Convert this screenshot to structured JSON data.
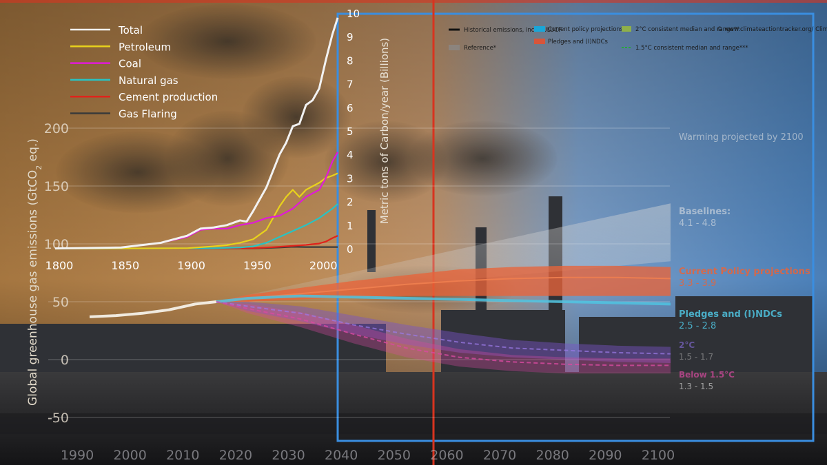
{
  "colors": {
    "sky_warm": "#b98a55",
    "sky_cool": "#5b8bbd",
    "frame_blue": "#3a8ee0",
    "divider_red": "#d8341f",
    "total": "#f2f2f2",
    "petroleum": "#e8d21c",
    "coal": "#e01ad8",
    "natural_gas": "#27c4c4",
    "cement": "#e0231b",
    "gas_flaring": "#3a3a3a",
    "current_policy": "#e8643a",
    "pledges": "#4fc3e0",
    "two_degree": "#7a55c8",
    "one_five_degree": "#d84aa0"
  },
  "chart_data": [
    {
      "type": "line",
      "xlabel": "",
      "ylabel": "Metric tons of Carbon/year (Billions)",
      "xlim": [
        1800,
        2014
      ],
      "ylim": [
        0,
        10
      ],
      "x_ticks": [
        "1800",
        "1850",
        "1900",
        "1950",
        "2000"
      ],
      "y_ticks": [
        "0",
        "1",
        "2",
        "3",
        "4",
        "5",
        "6",
        "7",
        "8",
        "9",
        "10"
      ],
      "legend_position": "top-left",
      "series": [
        {
          "name": "Total",
          "x": [
            1800,
            1850,
            1880,
            1900,
            1910,
            1920,
            1930,
            1940,
            1945,
            1950,
            1960,
            1970,
            1975,
            1980,
            1985,
            1990,
            1995,
            2000,
            2005,
            2010,
            2014
          ],
          "y": [
            0.01,
            0.05,
            0.25,
            0.55,
            0.85,
            0.9,
            1.0,
            1.2,
            1.15,
            1.6,
            2.6,
            4.0,
            4.5,
            5.2,
            5.3,
            6.1,
            6.3,
            6.8,
            8.0,
            9.1,
            9.8
          ]
        },
        {
          "name": "Petroleum",
          "x": [
            1800,
            1900,
            1920,
            1930,
            1940,
            1950,
            1960,
            1970,
            1975,
            1980,
            1985,
            1990,
            2000,
            2005,
            2010,
            2014
          ],
          "y": [
            0,
            0.02,
            0.1,
            0.15,
            0.25,
            0.4,
            0.8,
            1.8,
            2.2,
            2.5,
            2.2,
            2.5,
            2.8,
            3.0,
            3.1,
            3.2
          ]
        },
        {
          "name": "Coal",
          "x": [
            1800,
            1850,
            1880,
            1900,
            1910,
            1920,
            1930,
            1940,
            1950,
            1960,
            1970,
            1980,
            1990,
            2000,
            2005,
            2010,
            2014
          ],
          "y": [
            0.01,
            0.05,
            0.25,
            0.5,
            0.8,
            0.85,
            0.85,
            1.0,
            1.1,
            1.3,
            1.4,
            1.7,
            2.2,
            2.5,
            3.0,
            3.7,
            4.1
          ]
        },
        {
          "name": "Natural gas",
          "x": [
            1800,
            1920,
            1940,
            1950,
            1960,
            1970,
            1980,
            1990,
            2000,
            2005,
            2010,
            2014
          ],
          "y": [
            0,
            0.02,
            0.05,
            0.1,
            0.25,
            0.5,
            0.75,
            1.0,
            1.3,
            1.5,
            1.7,
            1.9
          ]
        },
        {
          "name": "Cement production",
          "x": [
            1800,
            1920,
            1950,
            1960,
            1970,
            1980,
            1990,
            2000,
            2005,
            2010,
            2014
          ],
          "y": [
            0,
            0.01,
            0.02,
            0.05,
            0.08,
            0.12,
            0.16,
            0.22,
            0.3,
            0.45,
            0.55
          ]
        },
        {
          "name": "Gas Flaring",
          "x": [
            1800,
            1950,
            1970,
            1980,
            1990,
            2000,
            2014
          ],
          "y": [
            0,
            0.01,
            0.05,
            0.08,
            0.07,
            0.07,
            0.07
          ]
        }
      ]
    },
    {
      "type": "line",
      "xlabel": "",
      "ylabel": "Global greenhouse gas emissions (GtCO₂eq.)",
      "ylabel_prefix": "Global greenhouse gas emissions (GtCO",
      "ylabel_sub": "2",
      "ylabel_suffix": " eq.)",
      "xlim": [
        1990,
        2100
      ],
      "ylim": [
        -50,
        200
      ],
      "x_ticks": [
        "1990",
        "2000",
        "2010",
        "2020",
        "2030",
        "2040",
        "2050",
        "2060",
        "2070",
        "2080",
        "2090",
        "2100"
      ],
      "y_ticks": [
        "-50",
        "0",
        "50",
        "100",
        "150",
        "200"
      ],
      "legend": [
        "Historical emissions, incl. LULUCF",
        "Reference*",
        "Current policy projections",
        "Pledges and (I)NDCs",
        "2°C consistent median and range**",
        "1.5°C consistent median and range***"
      ],
      "credit": "© www.climateactiontracker.org/ Climate Analytics/Ecofys/ NewClimate",
      "annotations": [
        {
          "title": "Warming projected by 2100",
          "value": ""
        },
        {
          "title": "Baselines:",
          "value": "4.1 - 4.8"
        },
        {
          "title": "Current Policy projections",
          "value": "3.3 - 3.9"
        },
        {
          "title": "Pledges and (I)NDCs",
          "value": "2.5 - 2.8"
        },
        {
          "title": "2°C",
          "value": "1.5 - 1.7"
        },
        {
          "title": "Below 1.5°C",
          "value": "1.3 - 1.5"
        }
      ],
      "series": [
        {
          "name": "Historical emissions, incl. LULUCF",
          "x": [
            1990,
            1995,
            2000,
            2005,
            2010,
            2014
          ],
          "y": [
            37,
            38,
            40,
            43,
            48,
            50
          ]
        },
        {
          "name": "Current policy projections",
          "x": [
            2014,
            2020,
            2030,
            2040,
            2050,
            2060,
            2070,
            2080,
            2090,
            2100
          ],
          "y": [
            50,
            53,
            57,
            61,
            65,
            68,
            70,
            71,
            71,
            70
          ],
          "range_low": [
            50,
            50,
            52,
            54,
            55,
            55,
            55,
            55,
            55,
            55
          ],
          "range_high": [
            50,
            56,
            62,
            68,
            73,
            78,
            80,
            81,
            81,
            80
          ]
        },
        {
          "name": "Pledges and (I)NDCs",
          "x": [
            2014,
            2020,
            2030,
            2040,
            2050,
            2060,
            2070,
            2080,
            2090,
            2100
          ],
          "y": [
            50,
            53,
            55,
            54,
            53,
            52,
            51,
            50,
            49,
            48
          ]
        },
        {
          "name": "2°C consistent median and range**",
          "x": [
            2014,
            2020,
            2030,
            2040,
            2050,
            2060,
            2070,
            2080,
            2090,
            2100
          ],
          "y": [
            50,
            46,
            40,
            30,
            22,
            15,
            10,
            8,
            6,
            5
          ],
          "range_low": [
            50,
            42,
            33,
            22,
            13,
            6,
            2,
            0,
            -2,
            -3
          ],
          "range_high": [
            50,
            50,
            46,
            38,
            30,
            23,
            17,
            14,
            12,
            11
          ]
        },
        {
          "name": "1.5°C consistent median and range***",
          "x": [
            2014,
            2020,
            2030,
            2040,
            2050,
            2060,
            2070,
            2080,
            2090,
            2100
          ],
          "y": [
            50,
            44,
            35,
            22,
            10,
            2,
            -2,
            -4,
            -5,
            -5
          ],
          "range_low": [
            50,
            40,
            28,
            14,
            2,
            -6,
            -10,
            -12,
            -12,
            -12
          ],
          "range_high": [
            50,
            48,
            41,
            30,
            18,
            9,
            4,
            2,
            1,
            1
          ]
        },
        {
          "name": "Reference*",
          "x": [
            2014,
            2100
          ],
          "y": [
            50,
            135
          ],
          "range_low": [
            50,
            85
          ],
          "range_high": [
            50,
            135
          ]
        }
      ]
    }
  ]
}
